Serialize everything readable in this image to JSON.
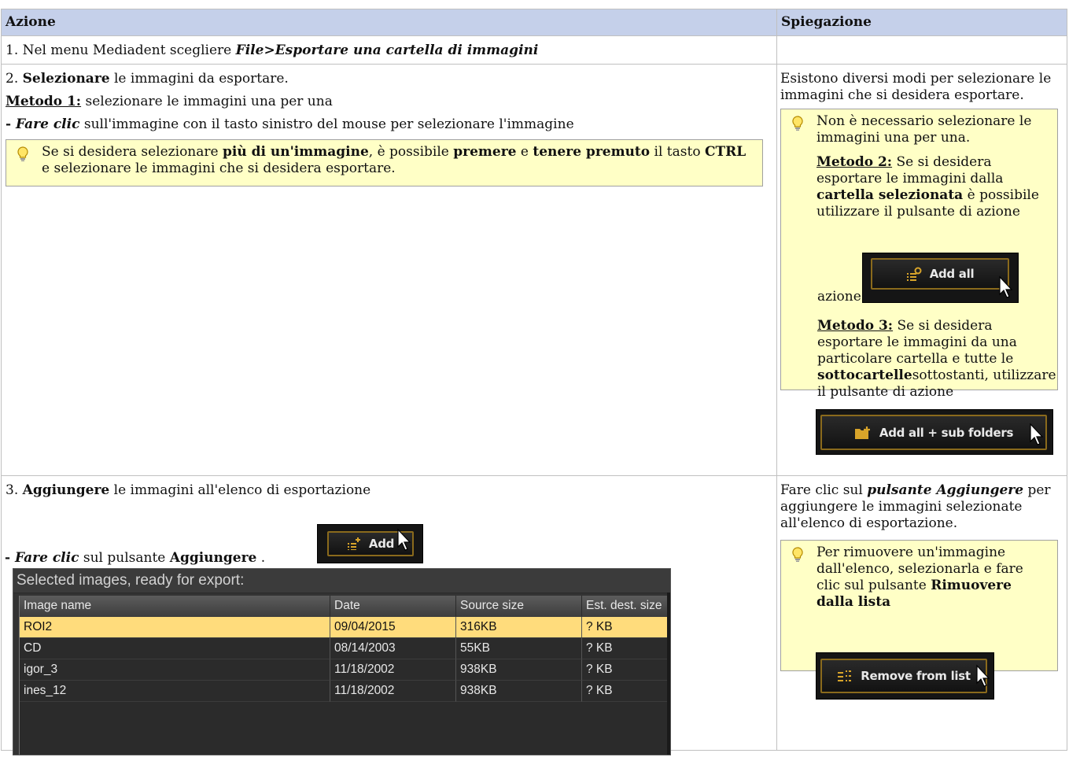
{
  "table": {
    "header_action": "Azione",
    "header_explanation": "Spiegazione"
  },
  "row1": {
    "prefix": "1. Nel menu Mediadent scegliere ",
    "menu_path": "File>Esportare una cartella di immagini"
  },
  "row2": {
    "num": "2. ",
    "select_bold": "Selezionare",
    "select_rest": " le immagini da esportare.",
    "method1_label": "Metodo 1:",
    "method1_text": " selezionare le immagini una per una",
    "click_dash": "- ",
    "click_bold": "Fare clic",
    "click_rest": " sull'immagine con il tasto sinistro del mouse per selezionare l'immagine",
    "tip": {
      "t1": "Se si desidera selezionare ",
      "b1": "più di un'immagine",
      "t2": ", è possibile ",
      "b2": "premere",
      "t3": " e ",
      "b3": "tenere premuto",
      "t4": " il tasto ",
      "b4": "CTRL",
      "t5": " e selezionare le immagini che si desidera esportare."
    },
    "explanation": "Esistono diversi modi per selezionare le immagini che si desidera esportare.",
    "tip2": {
      "intro": "Non è necessario selezionare le immagini una per una.",
      "m2_label": "Metodo 2:",
      "m2_t1": " Se si desidera esportare le immagini dalla ",
      "m2_b1": "cartella selezionata",
      "m2_t2": " è possibile utilizzare il pulsante di azione",
      "m3_label": "Metodo 3:",
      "m3_t1": " Se si desidera esportare le immagini da una particolare cartella e tutte le ",
      "m3_b1": "sottocartelle",
      "m3_t2": "sottostanti, utilizzare il pulsante di azione"
    },
    "btn_add_all": "Add all",
    "btn_add_all_sub": "Add all + sub folders"
  },
  "row3": {
    "num": "3. ",
    "add_bold": "Aggiungere",
    "add_rest": " le immagini all'elenco di esportazione",
    "click_dash": "- ",
    "click_bold": "Fare clic",
    "click_mid": " sul pulsante ",
    "click_btn_bold": "Aggiungere",
    "click_end": " .",
    "btn_add": "Add",
    "explanation_t1": "Fare clic sul ",
    "explanation_b1": "pulsante Aggiungere",
    "explanation_t2": " per aggiungere le immagini selezionate all'elenco di esportazione.",
    "tip": {
      "t1": "Per rimuovere un'immagine dall'elenco, selezionarla e fare clic sul pulsante ",
      "b1": "Rimuovere dalla lista"
    },
    "btn_remove": "Remove from list"
  },
  "export_list": {
    "title": "Selected images, ready for export:",
    "columns": [
      "Image name",
      "Date",
      "Source size",
      "Est. dest. size"
    ],
    "rows": [
      {
        "name": "ROI2",
        "date": "09/04/2015",
        "size": "316KB",
        "est": "? KB",
        "selected": true
      },
      {
        "name": "CD",
        "date": "08/14/2003",
        "size": "55KB",
        "est": "? KB",
        "selected": false
      },
      {
        "name": "igor_3",
        "date": "11/18/2002",
        "size": "938KB",
        "est": "? KB",
        "selected": false
      },
      {
        "name": "ines_12",
        "date": "11/18/2002",
        "size": "938KB",
        "est": "? KB",
        "selected": false
      }
    ]
  },
  "icons": [
    "lightbulb-icon",
    "add-all-icon",
    "add-folder-icon",
    "add-icon",
    "remove-list-icon",
    "mouse-cursor-icon"
  ]
}
